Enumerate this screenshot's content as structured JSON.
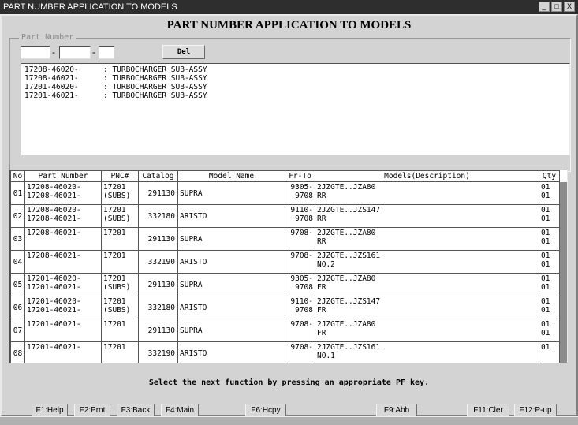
{
  "window": {
    "title": "PART NUMBER APPLICATION TO MODELS",
    "controls": [
      "_",
      "□",
      "X"
    ]
  },
  "heading": "PART NUMBER APPLICATION TO MODELS",
  "part_number": {
    "legend": "Part Number",
    "field1": "",
    "field2": "",
    "field3": "",
    "sep": "-",
    "del_label": "Del"
  },
  "part_list": [
    {
      "code": "17208-46020-",
      "desc": ": TURBOCHARGER SUB-ASSY"
    },
    {
      "code": "17208-46021-",
      "desc": ": TURBOCHARGER SUB-ASSY"
    },
    {
      "code": "17201-46020-",
      "desc": ": TURBOCHARGER SUB-ASSY"
    },
    {
      "code": "17201-46021-",
      "desc": ": TURBOCHARGER SUB-ASSY"
    }
  ],
  "table": {
    "headers": [
      "No",
      "Part Number",
      "PNC#",
      "Catalog",
      "Model Name",
      "Fr-To",
      "Models(Description)",
      "Qty"
    ],
    "rows": [
      {
        "no": "01",
        "pn": [
          "17208-46020-",
          "17208-46021-"
        ],
        "pnc": [
          "17201",
          "(SUBS)"
        ],
        "catalog": "291130",
        "model": "SUPRA",
        "frto": [
          "9305-",
          "9708"
        ],
        "desc": [
          "2JZGTE..JZA80",
          "RR"
        ],
        "qty": [
          "01",
          "01"
        ]
      },
      {
        "no": "02",
        "pn": [
          "17208-46020-",
          "17208-46021-"
        ],
        "pnc": [
          "17201",
          "(SUBS)"
        ],
        "catalog": "332180",
        "model": "ARISTO",
        "frto": [
          "9110-",
          "9708"
        ],
        "desc": [
          "2JZGTE..JZS147",
          "RR"
        ],
        "qty": [
          "01",
          "01"
        ]
      },
      {
        "no": "03",
        "pn": [
          "17208-46021-",
          ""
        ],
        "pnc": [
          "17201",
          ""
        ],
        "catalog": "291130",
        "model": "SUPRA",
        "frto": [
          "9708-",
          ""
        ],
        "desc": [
          "2JZGTE..JZA80",
          "RR"
        ],
        "qty": [
          "01",
          "01"
        ]
      },
      {
        "no": "04",
        "pn": [
          "17208-46021-",
          ""
        ],
        "pnc": [
          "17201",
          ""
        ],
        "catalog": "332190",
        "model": "ARISTO",
        "frto": [
          "9708-",
          ""
        ],
        "desc": [
          "2JZGTE..JZS161",
          "NO.2"
        ],
        "qty": [
          "01",
          "01"
        ]
      },
      {
        "no": "05",
        "pn": [
          "17201-46020-",
          "17201-46021-"
        ],
        "pnc": [
          "17201",
          "(SUBS)"
        ],
        "catalog": "291130",
        "model": "SUPRA",
        "frto": [
          "9305-",
          "9708"
        ],
        "desc": [
          "2JZGTE..JZA80",
          "FR"
        ],
        "qty": [
          "01",
          "01"
        ]
      },
      {
        "no": "06",
        "pn": [
          "17201-46020-",
          "17201-46021-"
        ],
        "pnc": [
          "17201",
          "(SUBS)"
        ],
        "catalog": "332180",
        "model": "ARISTO",
        "frto": [
          "9110-",
          "9708"
        ],
        "desc": [
          "2JZGTE..JZS147",
          "FR"
        ],
        "qty": [
          "01",
          "01"
        ]
      },
      {
        "no": "07",
        "pn": [
          "17201-46021-",
          ""
        ],
        "pnc": [
          "17201",
          ""
        ],
        "catalog": "291130",
        "model": "SUPRA",
        "frto": [
          "9708-",
          ""
        ],
        "desc": [
          "2JZGTE..JZA80",
          "FR"
        ],
        "qty": [
          "01",
          "01"
        ]
      },
      {
        "no": "08",
        "pn": [
          "17201-46021-",
          ""
        ],
        "pnc": [
          "17201",
          ""
        ],
        "catalog": "332190",
        "model": "ARISTO",
        "frto": [
          "9708-",
          ""
        ],
        "desc": [
          "2JZGTE..JZS161",
          "NO.1"
        ],
        "qty": [
          "01",
          ""
        ]
      }
    ]
  },
  "status_message": "Select the next function by pressing an appropriate PF key.",
  "function_keys": [
    {
      "id": "f1",
      "label": "F1:Help"
    },
    {
      "id": "f2",
      "label": "F2:Prnt"
    },
    {
      "id": "f3",
      "label": "F3:Back"
    },
    {
      "id": "f4",
      "label": "F4:Main"
    },
    {
      "id": "f6",
      "label": "F6:Hcpy"
    },
    {
      "id": "f9",
      "label": "F9:Abb"
    },
    {
      "id": "f11",
      "label": "F11:Cler"
    },
    {
      "id": "f12",
      "label": "F12:P-up"
    }
  ]
}
